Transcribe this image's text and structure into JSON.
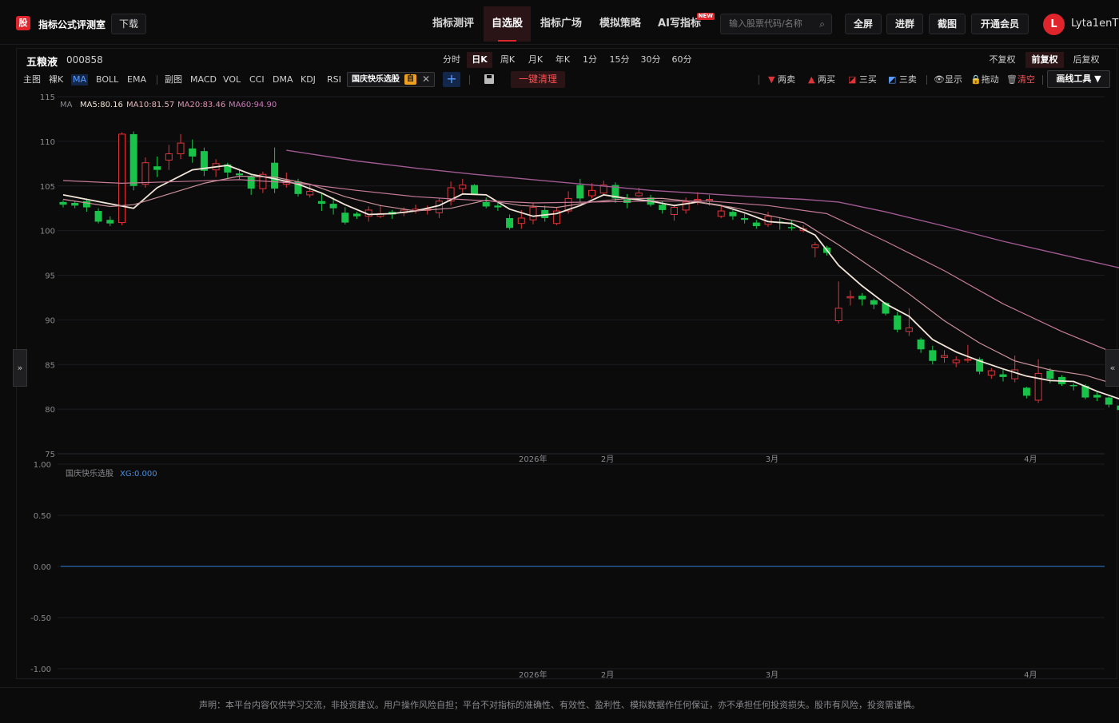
{
  "app": {
    "brand": "指标公式评测室",
    "logo_char": "股",
    "download": "下载"
  },
  "nav": [
    "指标测评",
    "自选股",
    "指标广场",
    "模拟策略",
    "AI写指标"
  ],
  "nav_active": "自选股",
  "new_tag": "NEW",
  "search": {
    "placeholder": "输入股票代码/名称"
  },
  "top_buttons": [
    "全屏",
    "进群",
    "截图",
    "开通会员"
  ],
  "user": {
    "initial": "L",
    "name": "Lyta1enT"
  },
  "stock": {
    "name": "五粮液",
    "code": "000858"
  },
  "periods": [
    "分时",
    "日K",
    "周K",
    "月K",
    "年K",
    "1分",
    "15分",
    "30分",
    "60分"
  ],
  "period_active": "日K",
  "adjust": [
    "不复权",
    "前复权",
    "后复权"
  ],
  "adjust_active": "前复权",
  "indicators_main": [
    "主图",
    "裸K",
    "MA",
    "BOLL",
    "EMA"
  ],
  "indicators_sub": [
    "副图",
    "MACD",
    "VOL",
    "CCI",
    "DMA",
    "KDJ",
    "RSI"
  ],
  "custom_indicator": {
    "name": "国庆快乐选股",
    "tag": "自"
  },
  "clear_all": "一键清理",
  "draw": {
    "two_sell": "两卖",
    "two_buy": "两买",
    "three_buy": "三买",
    "three_sell": "三卖",
    "show": "显示",
    "drag": "拖动",
    "clear": "清空",
    "tools": "画线工具 ▼"
  },
  "ma_legend": {
    "title": "MA",
    "ma5": "MA5:80.16",
    "ma10": "MA10:81.57",
    "ma20": "MA20:83.46",
    "ma60": "MA60:94.90"
  },
  "sub_legend": {
    "name": "国庆快乐选股",
    "value": "XG:0.000"
  },
  "footer": "声明：本平台内容仅供学习交流，非投资建议。用户操作风险自担；平台不对指标的准确性、有效性、盈利性、模拟数据作任何保证，亦不承担任何投资损失。股市有风险，投资需谨慎。",
  "colors": {
    "up": "#e0343a",
    "down": "#19c34a",
    "ma5": "#f3e5d8",
    "ma10": "#c9919a",
    "ma20": "#c67a97",
    "ma60": "#a15a92",
    "accent": "#e0242b"
  },
  "chart_data": {
    "type": "candlestick",
    "y_main": {
      "min": 75,
      "max": 115,
      "ticks": [
        "115",
        "110",
        "105",
        "100",
        "95",
        "90",
        "85",
        "80",
        "75"
      ]
    },
    "y_sub": {
      "min": -1,
      "max": 1,
      "ticks": [
        "1.00",
        "0.50",
        "0.00",
        "-0.50",
        "-1.00"
      ]
    },
    "x_labels": [
      "2026年",
      "2月",
      "3月",
      "4月"
    ],
    "candles": [
      [
        103.2,
        102.9,
        103.4,
        102.6
      ],
      [
        103.1,
        102.8,
        103.3,
        102.5
      ],
      [
        103.3,
        102.6,
        103.6,
        102.1
      ],
      [
        102.2,
        101.0,
        102.5,
        100.8
      ],
      [
        101.2,
        100.8,
        101.6,
        100.5
      ],
      [
        100.9,
        110.8,
        111.0,
        100.6
      ],
      [
        110.8,
        105.0,
        111.1,
        104.5
      ],
      [
        105.2,
        107.6,
        108.2,
        104.8
      ],
      [
        107.2,
        106.8,
        108.3,
        106.0
      ],
      [
        107.9,
        108.6,
        109.6,
        106.8
      ],
      [
        108.6,
        109.8,
        110.8,
        108.0
      ],
      [
        109.2,
        108.3,
        110.2,
        107.6
      ],
      [
        108.9,
        106.7,
        109.3,
        106.1
      ],
      [
        106.8,
        107.5,
        108.0,
        106.0
      ],
      [
        107.4,
        106.5,
        107.6,
        105.8
      ],
      [
        106.4,
        106.2,
        106.9,
        105.7
      ],
      [
        106.0,
        104.7,
        106.2,
        104.0
      ],
      [
        104.7,
        106.3,
        106.6,
        104.2
      ],
      [
        107.6,
        104.7,
        109.3,
        104.2
      ],
      [
        105.2,
        105.6,
        106.5,
        104.8
      ],
      [
        105.5,
        104.1,
        105.8,
        103.8
      ],
      [
        104.0,
        104.4,
        105.1,
        103.7
      ],
      [
        103.3,
        103.0,
        104.1,
        102.2
      ],
      [
        103.0,
        102.5,
        103.7,
        101.8
      ],
      [
        102.0,
        100.9,
        102.6,
        100.7
      ],
      [
        101.9,
        101.6,
        102.1,
        101.3
      ],
      [
        101.6,
        102.3,
        102.7,
        101.0
      ],
      [
        101.6,
        101.9,
        102.9,
        101.4
      ],
      [
        102.1,
        101.8,
        102.3,
        101.3
      ],
      [
        102.0,
        102.3,
        102.6,
        101.6
      ],
      [
        102.2,
        102.4,
        102.9,
        101.9
      ],
      [
        102.4,
        102.4,
        102.8,
        101.8
      ],
      [
        102.0,
        103.3,
        103.6,
        101.4
      ],
      [
        103.3,
        104.8,
        105.5,
        102.8
      ],
      [
        104.7,
        105.1,
        105.8,
        104.2
      ],
      [
        105.1,
        104.1,
        105.2,
        104.0
      ],
      [
        103.2,
        102.7,
        103.7,
        102.5
      ],
      [
        102.8,
        102.6,
        103.2,
        102.2
      ],
      [
        101.4,
        100.3,
        101.8,
        100.1
      ],
      [
        100.8,
        101.4,
        102.3,
        100.2
      ],
      [
        101.2,
        102.6,
        103.1,
        100.7
      ],
      [
        102.3,
        101.4,
        102.8,
        101.0
      ],
      [
        100.8,
        102.2,
        102.6,
        100.6
      ],
      [
        102.2,
        103.6,
        104.4,
        101.9
      ],
      [
        105.1,
        103.6,
        105.8,
        103.2
      ],
      [
        103.9,
        104.5,
        105.3,
        103.6
      ],
      [
        104.2,
        105.1,
        105.6,
        103.9
      ],
      [
        105.1,
        103.6,
        105.4,
        103.1
      ],
      [
        103.5,
        103.1,
        104.1,
        102.5
      ],
      [
        103.9,
        104.2,
        104.8,
        103.8
      ],
      [
        103.7,
        102.9,
        104.0,
        102.7
      ],
      [
        102.9,
        102.3,
        103.3,
        101.9
      ],
      [
        101.8,
        102.6,
        102.9,
        101.1
      ],
      [
        102.3,
        103.2,
        103.7,
        101.9
      ],
      [
        103.4,
        103.5,
        104.3,
        102.9
      ],
      [
        103.4,
        103.5,
        104.0,
        102.8
      ],
      [
        101.6,
        102.2,
        102.8,
        101.4
      ],
      [
        102.1,
        101.6,
        102.3,
        101.2
      ],
      [
        101.4,
        101.2,
        101.9,
        100.8
      ],
      [
        100.9,
        100.5,
        101.2,
        100.2
      ],
      [
        100.7,
        101.6,
        102.1,
        100.4
      ],
      [
        101.0,
        100.9,
        101.5,
        100.1
      ],
      [
        100.4,
        100.3,
        101.2,
        100.0
      ],
      [
        100.0,
        100.2,
        100.6,
        99.8
      ],
      [
        98.1,
        98.4,
        98.7,
        97.0
      ],
      [
        98.1,
        97.5,
        98.3,
        97.2
      ],
      [
        89.9,
        91.3,
        94.3,
        89.6
      ],
      [
        92.5,
        92.6,
        93.3,
        91.6
      ],
      [
        92.7,
        92.3,
        93.0,
        91.6
      ],
      [
        92.2,
        91.7,
        92.4,
        91.2
      ],
      [
        91.9,
        90.7,
        92.0,
        90.5
      ],
      [
        90.5,
        88.9,
        90.9,
        88.6
      ],
      [
        88.7,
        89.1,
        91.3,
        88.2
      ],
      [
        87.8,
        86.7,
        88.0,
        86.3
      ],
      [
        86.6,
        85.4,
        87.1,
        85.0
      ],
      [
        85.8,
        86.0,
        86.6,
        85.2
      ],
      [
        85.2,
        85.5,
        85.9,
        84.7
      ],
      [
        85.6,
        85.6,
        87.2,
        85.2
      ],
      [
        85.6,
        84.2,
        85.8,
        83.9
      ],
      [
        83.8,
        84.3,
        84.6,
        83.4
      ],
      [
        83.9,
        83.6,
        84.4,
        83.1
      ],
      [
        83.4,
        84.4,
        86.0,
        83.0
      ],
      [
        82.4,
        81.5,
        82.5,
        81.2
      ],
      [
        81.0,
        84.0,
        85.6,
        80.7
      ],
      [
        84.3,
        83.4,
        84.6,
        82.9
      ],
      [
        83.6,
        82.8,
        83.8,
        82.6
      ],
      [
        82.7,
        82.6,
        82.9,
        82.1
      ],
      [
        82.6,
        81.3,
        82.8,
        81.1
      ],
      [
        81.6,
        81.3,
        81.9,
        80.9
      ],
      [
        81.3,
        80.5,
        81.4,
        80.2
      ],
      [
        80.4,
        79.9,
        80.6,
        79.6
      ],
      [
        79.7,
        79.1,
        79.8,
        78.9
      ],
      [
        78.9,
        79.5,
        79.9,
        78.6
      ]
    ],
    "series": [
      {
        "name": "MA5",
        "values": [
          [
            0,
            104
          ],
          [
            4,
            103
          ],
          [
            6,
            102.5
          ],
          [
            8,
            104.8
          ],
          [
            11,
            106.8
          ],
          [
            14,
            107.3
          ],
          [
            16,
            106.3
          ],
          [
            18,
            105.8
          ],
          [
            20,
            105.2
          ],
          [
            22,
            104.2
          ],
          [
            24,
            102.9
          ],
          [
            26,
            101.8
          ],
          [
            28,
            101.9
          ],
          [
            30,
            102.2
          ],
          [
            32,
            102.8
          ],
          [
            34,
            104.1
          ],
          [
            36,
            104.0
          ],
          [
            38,
            102.4
          ],
          [
            40,
            101.6
          ],
          [
            42,
            101.9
          ],
          [
            44,
            102.8
          ],
          [
            46,
            104.0
          ],
          [
            48,
            103.6
          ],
          [
            50,
            103.3
          ],
          [
            52,
            102.8
          ],
          [
            54,
            103.2
          ],
          [
            56,
            102.8
          ],
          [
            58,
            102.0
          ],
          [
            60,
            101.0
          ],
          [
            62,
            100.8
          ],
          [
            64,
            99.5
          ],
          [
            66,
            96.1
          ],
          [
            68,
            93.8
          ],
          [
            70,
            91.8
          ],
          [
            72,
            90.4
          ],
          [
            74,
            87.8
          ],
          [
            76,
            86.4
          ],
          [
            78,
            85.4
          ],
          [
            80,
            84.5
          ],
          [
            82,
            83.7
          ],
          [
            84,
            83.2
          ],
          [
            86,
            83.1
          ],
          [
            88,
            82.0
          ],
          [
            90,
            81.1
          ],
          [
            92,
            80.2
          ]
        ]
      },
      {
        "name": "MA10",
        "values": [
          [
            0,
            103.5
          ],
          [
            4,
            102.7
          ],
          [
            6,
            102.9
          ],
          [
            8,
            103.7
          ],
          [
            10,
            104.5
          ],
          [
            12,
            105.3
          ],
          [
            15,
            106.1
          ],
          [
            18,
            106.0
          ],
          [
            21,
            105.2
          ],
          [
            24,
            103.8
          ],
          [
            27,
            102.8
          ],
          [
            30,
            102.2
          ],
          [
            33,
            102.5
          ],
          [
            36,
            103.4
          ],
          [
            39,
            102.8
          ],
          [
            42,
            102.6
          ],
          [
            45,
            103.2
          ],
          [
            48,
            103.6
          ],
          [
            51,
            103.6
          ],
          [
            54,
            103.2
          ],
          [
            57,
            102.6
          ],
          [
            60,
            101.7
          ],
          [
            63,
            100.9
          ],
          [
            66,
            98.4
          ],
          [
            69,
            95.7
          ],
          [
            72,
            92.9
          ],
          [
            75,
            89.9
          ],
          [
            78,
            87.4
          ],
          [
            81,
            85.4
          ],
          [
            84,
            84.4
          ],
          [
            87,
            83.8
          ],
          [
            90,
            82.6
          ],
          [
            92,
            81.6
          ]
        ]
      },
      {
        "name": "MA20",
        "values": [
          [
            0,
            105.6
          ],
          [
            5,
            105.3
          ],
          [
            10,
            105.5
          ],
          [
            15,
            105.7
          ],
          [
            20,
            105.3
          ],
          [
            25,
            104.5
          ],
          [
            30,
            103.8
          ],
          [
            35,
            103.4
          ],
          [
            40,
            103.1
          ],
          [
            45,
            103.2
          ],
          [
            50,
            103.3
          ],
          [
            55,
            103.3
          ],
          [
            60,
            102.8
          ],
          [
            65,
            101.9
          ],
          [
            70,
            98.8
          ],
          [
            75,
            95.5
          ],
          [
            80,
            91.8
          ],
          [
            85,
            88.7
          ],
          [
            90,
            86.0
          ],
          [
            92,
            84.9
          ]
        ]
      },
      {
        "name": "MA60",
        "values": [
          [
            19,
            109.0
          ],
          [
            25,
            107.8
          ],
          [
            30,
            107.0
          ],
          [
            35,
            106.3
          ],
          [
            40,
            105.7
          ],
          [
            45,
            105.1
          ],
          [
            50,
            104.5
          ],
          [
            55,
            104.1
          ],
          [
            60,
            103.7
          ],
          [
            63,
            103.5
          ],
          [
            66,
            103.2
          ],
          [
            70,
            102.1
          ],
          [
            75,
            100.5
          ],
          [
            80,
            98.8
          ],
          [
            85,
            97.3
          ],
          [
            90,
            95.8
          ],
          [
            92,
            94.9
          ]
        ]
      }
    ],
    "xg_value": 0
  }
}
